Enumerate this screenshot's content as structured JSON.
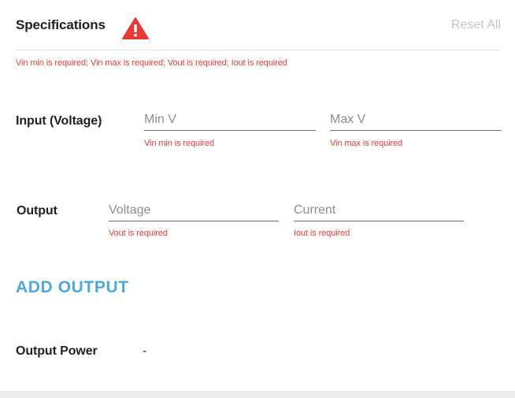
{
  "header": {
    "title": "Specifications",
    "reset_label": "Reset All",
    "warning_icon": "warning-triangle-icon",
    "warning_color": "#e53935"
  },
  "error_summary": "Vin min is required; Vin max is required; Vout is required; Iout is required",
  "input": {
    "label": "Input (Voltage)",
    "min": {
      "placeholder": "Min V",
      "value": "",
      "error": "Vin min is required"
    },
    "max": {
      "placeholder": "Max V",
      "value": "",
      "error": "Vin max is required"
    }
  },
  "output": {
    "label": "Output",
    "voltage": {
      "placeholder": "Voltage",
      "value": "",
      "error": "Vout is required"
    },
    "current": {
      "placeholder": "Current",
      "value": "",
      "error": "Iout is required"
    }
  },
  "add_output_label": "ADD OUTPUT",
  "output_power": {
    "label": "Output Power",
    "value": "-"
  },
  "colors": {
    "error": "#e53935",
    "accent": "#4ba9df",
    "muted": "#c6c6c6"
  }
}
